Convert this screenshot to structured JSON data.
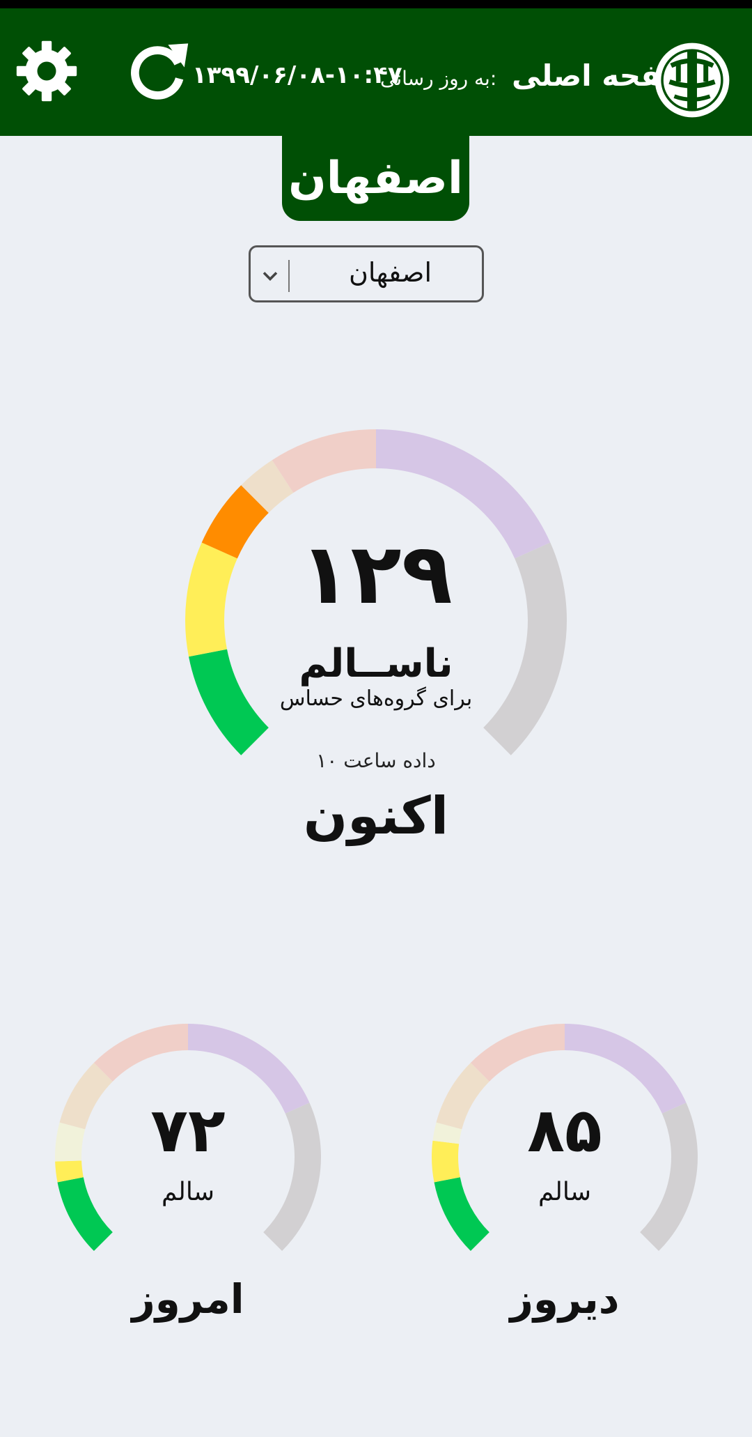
{
  "header": {
    "title": "صفحه اصلی",
    "update_label": "به روز رسانی:",
    "update_time": "۱۳۹۹/۰۶/۰۸-۱۰:۴۷"
  },
  "city": {
    "tab_label": "اصفهان",
    "select_value": "اصفهان"
  },
  "current": {
    "aqi": "۱۲۹",
    "status": "ناســالم",
    "note": "برای گروه‌های حساس",
    "data_hour": "داده ساعت ۱۰",
    "label": "اکنون"
  },
  "today": {
    "aqi": "۷۲",
    "status": "سالم",
    "label": "امروز"
  },
  "yesterday": {
    "aqi": "۸۵",
    "status": "سالم",
    "label": "دیروز"
  },
  "gauge_scale": {
    "colors": {
      "good": "#00c853",
      "moderate": "#ffee58",
      "usg": "#ff8c00",
      "unhealthy": "#f0cfc8",
      "very_unhealthy": "#d6c6e6",
      "hazardous": "#d2d0d2"
    },
    "faded": {
      "moderate": "#f1f2da",
      "usg": "#eedfca"
    }
  },
  "icons": [
    "gear-icon",
    "refresh-icon",
    "doe-logo",
    "chevron-down-icon"
  ]
}
